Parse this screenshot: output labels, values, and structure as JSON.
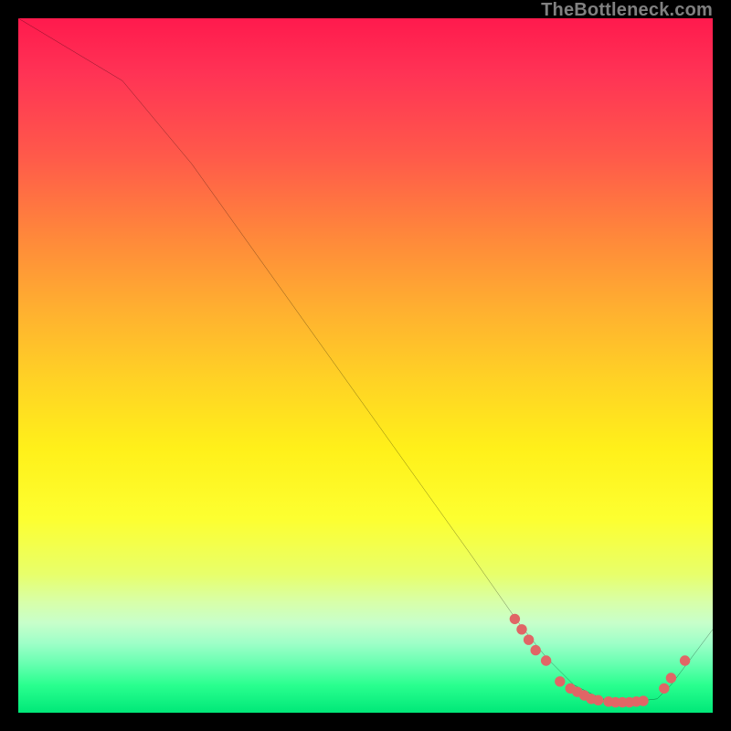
{
  "watermark": "TheBottleneck.com",
  "chart_data": {
    "type": "line",
    "title": "",
    "xlabel": "",
    "ylabel": "",
    "xlim": [
      0,
      100
    ],
    "ylim": [
      0,
      100
    ],
    "series": [
      {
        "name": "curve",
        "x": [
          0,
          5,
          15,
          25,
          35,
          45,
          55,
          65,
          72,
          76,
          80,
          84,
          88,
          92,
          94,
          100
        ],
        "y": [
          100,
          97,
          91,
          79,
          65,
          51,
          37,
          23,
          13,
          8,
          4,
          2,
          1.5,
          2,
          4,
          12
        ]
      }
    ],
    "markers": {
      "name": "dots",
      "color": "#e06666",
      "points": [
        {
          "x": 71.5,
          "y": 13.5
        },
        {
          "x": 72.5,
          "y": 12
        },
        {
          "x": 73.5,
          "y": 10.5
        },
        {
          "x": 74.5,
          "y": 9
        },
        {
          "x": 76,
          "y": 7.5
        },
        {
          "x": 78,
          "y": 4.5
        },
        {
          "x": 79.5,
          "y": 3.5
        },
        {
          "x": 80.5,
          "y": 3
        },
        {
          "x": 81.5,
          "y": 2.5
        },
        {
          "x": 82.5,
          "y": 2
        },
        {
          "x": 83.5,
          "y": 1.8
        },
        {
          "x": 85,
          "y": 1.6
        },
        {
          "x": 86,
          "y": 1.5
        },
        {
          "x": 87,
          "y": 1.5
        },
        {
          "x": 88,
          "y": 1.5
        },
        {
          "x": 89,
          "y": 1.6
        },
        {
          "x": 90,
          "y": 1.7
        },
        {
          "x": 93,
          "y": 3.5
        },
        {
          "x": 94,
          "y": 5
        },
        {
          "x": 96,
          "y": 7.5
        }
      ]
    }
  }
}
